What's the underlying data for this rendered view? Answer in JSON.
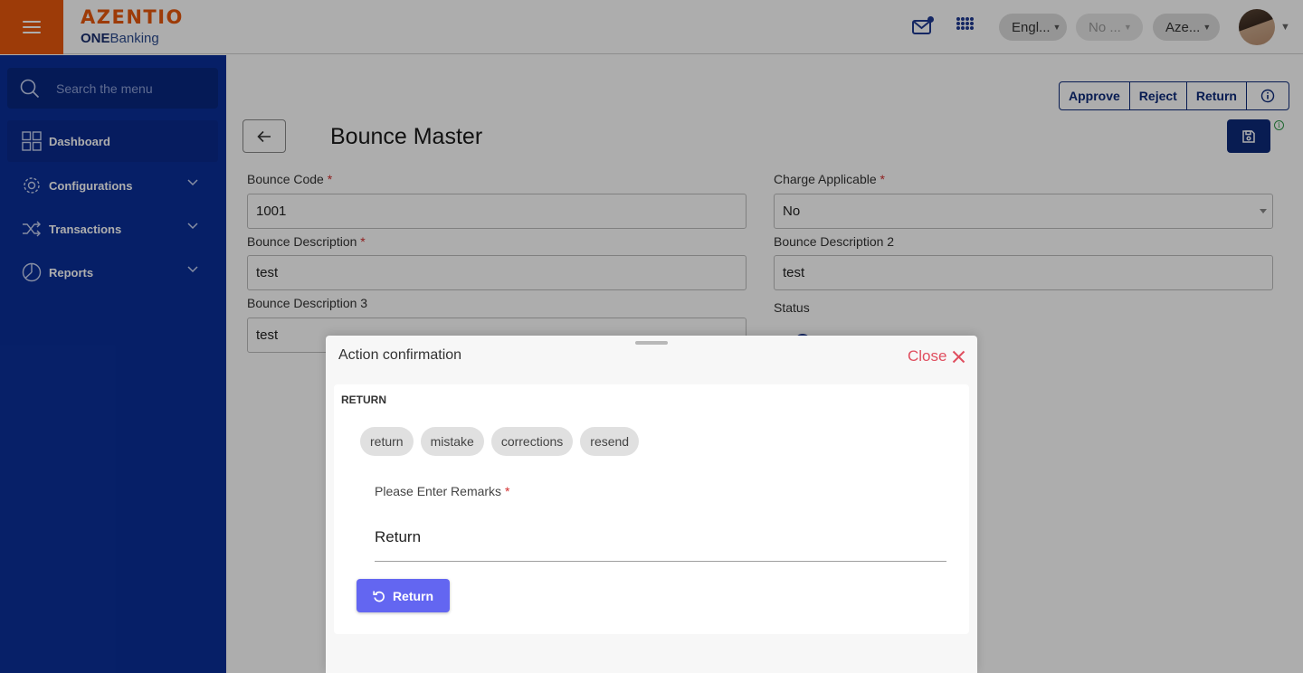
{
  "header": {
    "brand": "AZENTIO",
    "product_bold": "ONE",
    "product_rest": "Banking",
    "language_pill": "Engl...",
    "no_pill": "No ...",
    "entity_pill": "Aze..."
  },
  "sidebar": {
    "search_placeholder": "Search the menu",
    "items": [
      {
        "label": "Dashboard",
        "icon": "dashboard-icon"
      },
      {
        "label": "Configurations",
        "icon": "gear-icon"
      },
      {
        "label": "Transactions",
        "icon": "shuffle-icon"
      },
      {
        "label": "Reports",
        "icon": "pie-chart-icon"
      }
    ]
  },
  "actions": {
    "approve": "Approve",
    "reject": "Reject",
    "return": "Return"
  },
  "page": {
    "title": "Bounce Master"
  },
  "form": {
    "bounce_code": {
      "label": "Bounce Code",
      "value": "1001"
    },
    "charge_applicable": {
      "label": "Charge Applicable",
      "value": "No"
    },
    "bounce_description": {
      "label": "Bounce Description",
      "value": "test"
    },
    "bounce_description_2": {
      "label": "Bounce Description 2",
      "value": "test"
    },
    "bounce_description_3": {
      "label": "Bounce Description 3",
      "value": "test"
    },
    "status": {
      "label": "Status"
    },
    "required_mark": "*"
  },
  "modal": {
    "title": "Action confirmation",
    "close_label": "Close",
    "heading": "RETURN",
    "chips": [
      "return",
      "mistake",
      "corrections",
      "resend"
    ],
    "remarks_label": "Please Enter Remarks",
    "remarks_value": "Return",
    "submit_label": "Return"
  },
  "colors": {
    "brand_orange": "#e8580c",
    "sidebar_blue": "#0a2f99",
    "primary_navy": "#0d2a7a",
    "return_button": "#6366f1",
    "close_red": "#e04e5f"
  }
}
